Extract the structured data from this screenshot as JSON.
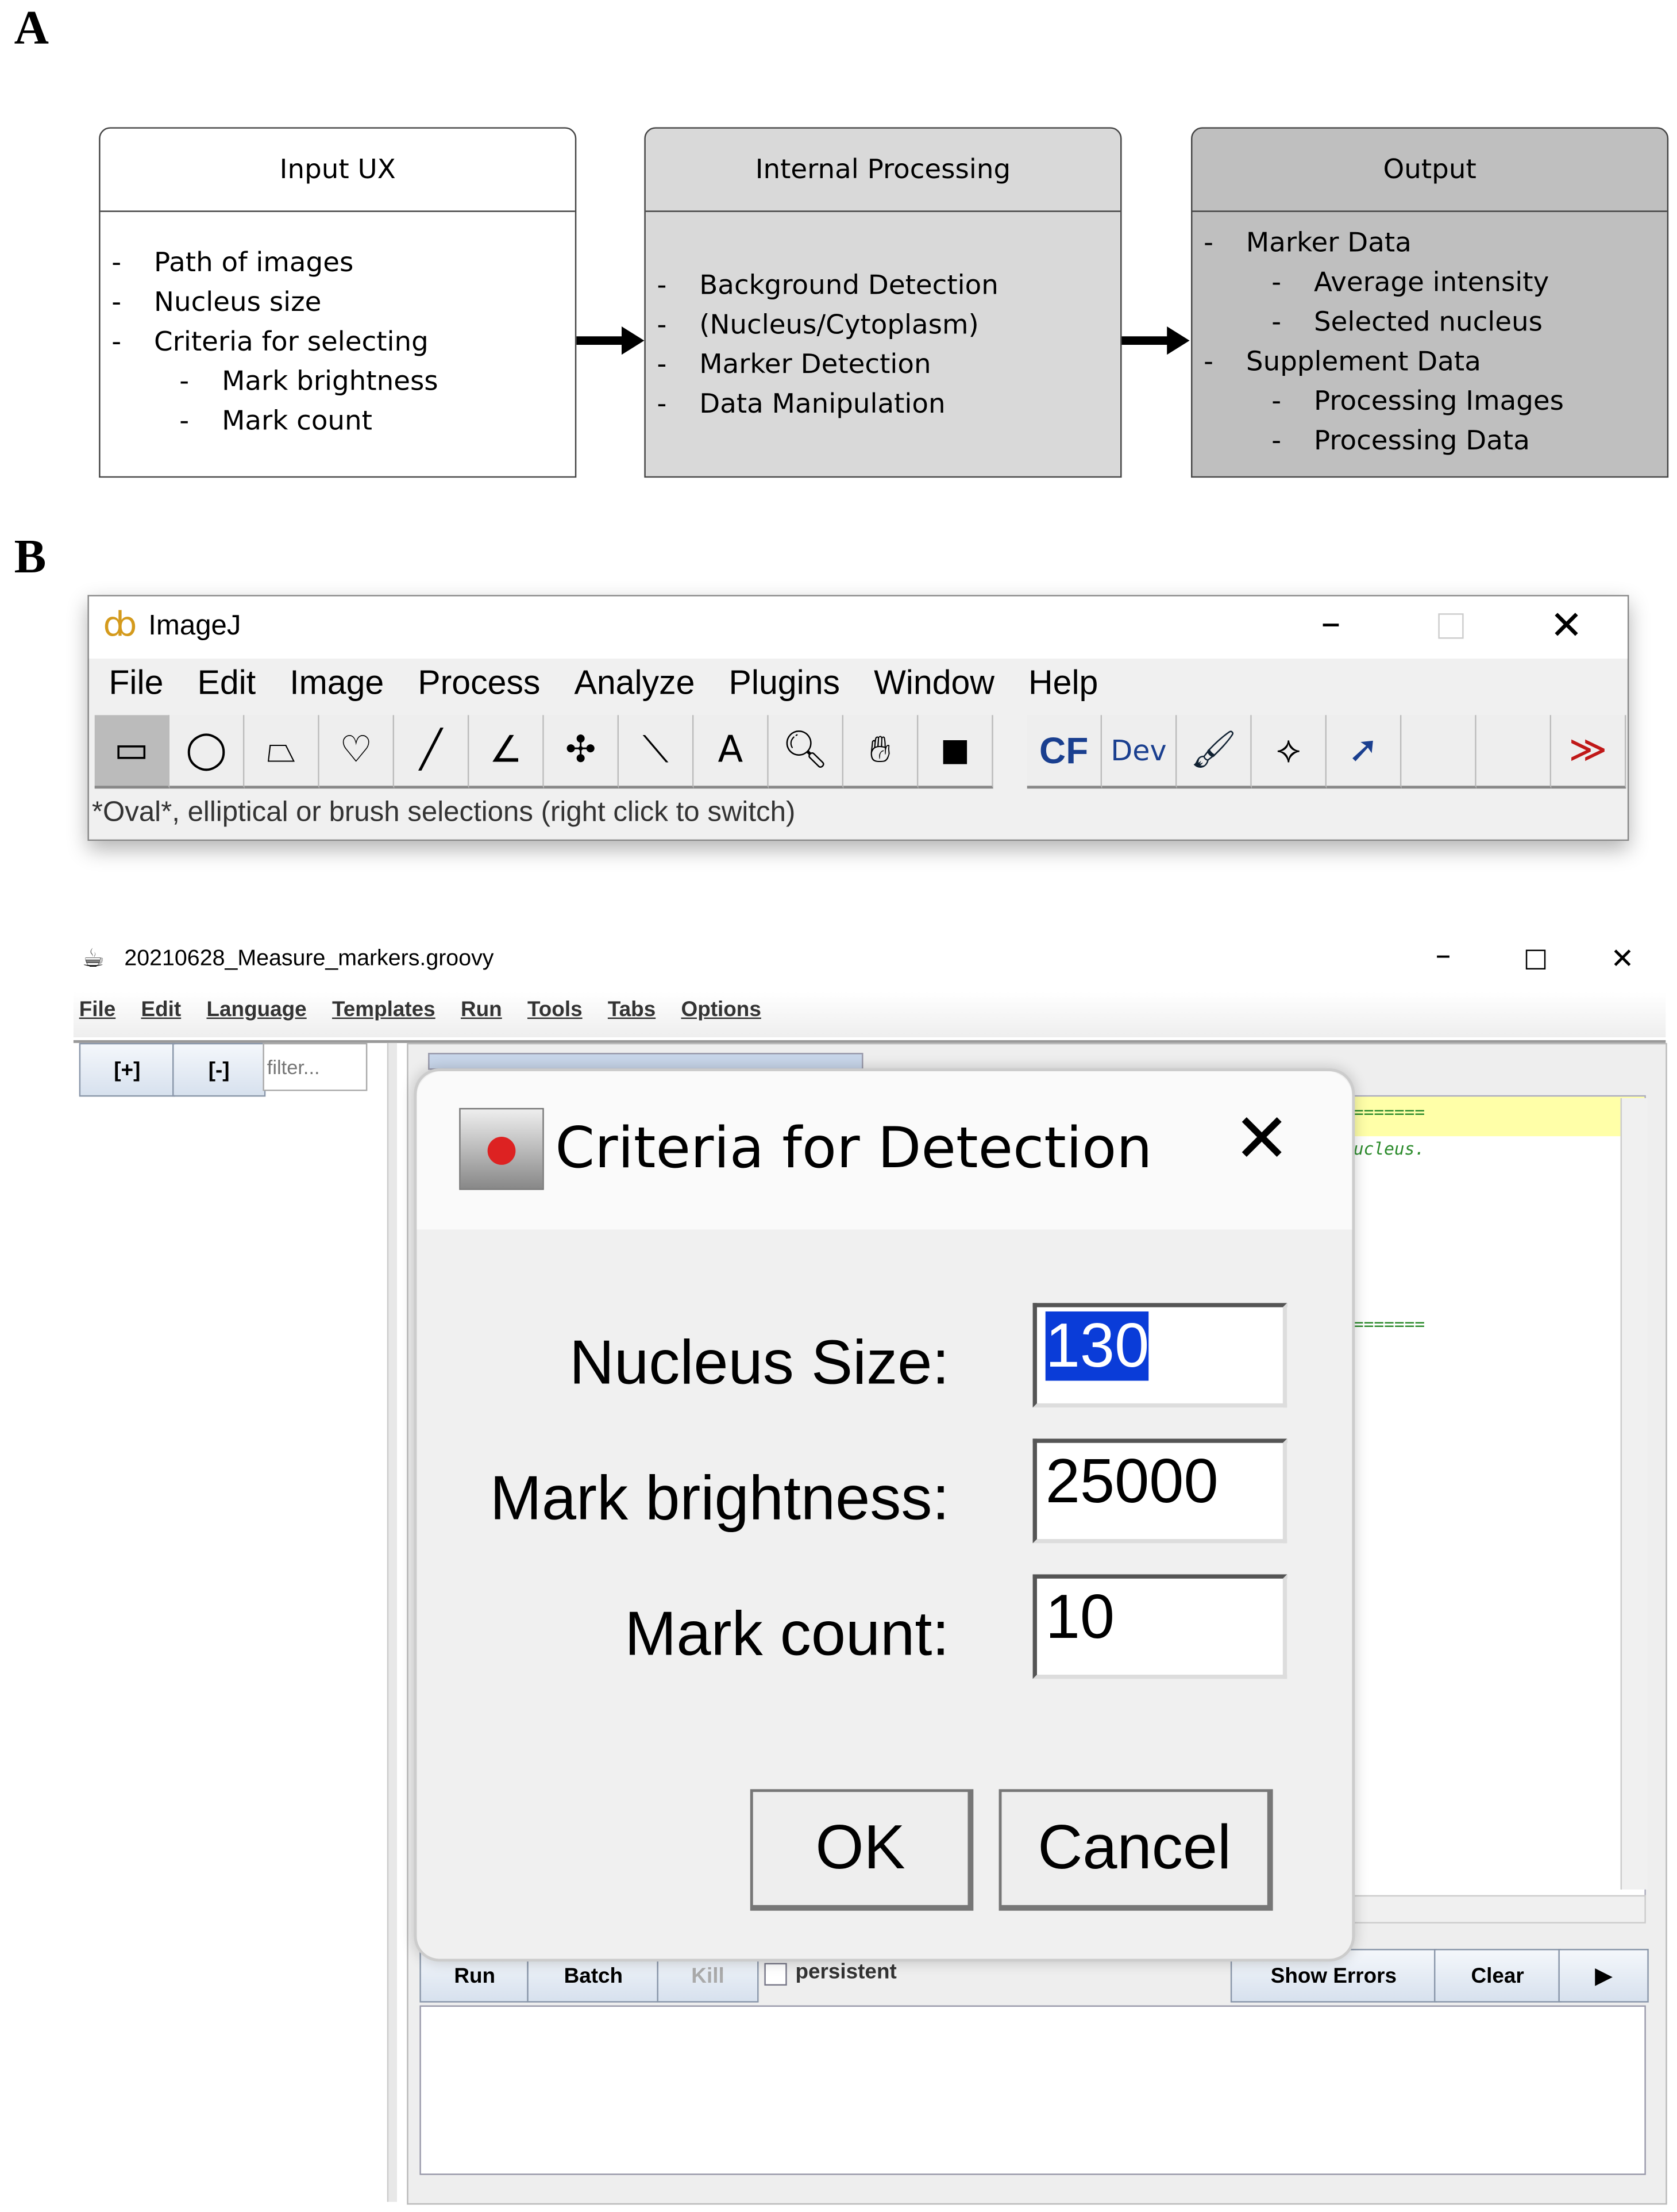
{
  "panel_a": {
    "label": "A",
    "input": {
      "title": "Input UX",
      "items": [
        "Path of images",
        "Nucleus size",
        "Criteria for selecting"
      ],
      "subitems": [
        "Mark brightness",
        "Mark count"
      ]
    },
    "internal": {
      "title": "Internal Processing",
      "items": [
        "Background  Detection",
        "(Nucleus/Cytoplasm)",
        "Marker Detection",
        "Data Manipulation"
      ]
    },
    "output": {
      "title": "Output",
      "marker": "Marker Data",
      "marker_sub": [
        "Average intensity",
        "Selected nucleus"
      ],
      "supplement": "Supplement Data",
      "supplement_sub": [
        "Processing Images",
        "Processing Data"
      ]
    }
  },
  "panel_b": {
    "label": "B"
  },
  "imagej": {
    "title": "ImageJ",
    "menu": [
      "File",
      "Edit",
      "Image",
      "Process",
      "Analyze",
      "Plugins",
      "Window",
      "Help"
    ],
    "tools": [
      "rectangle",
      "oval",
      "polygon",
      "freehand",
      "line",
      "angle",
      "multipoint",
      "wand",
      "text",
      "magnifier",
      "hand",
      "color-picker",
      "CF",
      "Dev",
      "brush",
      "flood-fill",
      "arrow",
      "empty",
      "empty",
      "more"
    ],
    "tool_cf": "CF",
    "tool_dev": "Dev",
    "more_glyph": "≫",
    "status": "*Oval*, elliptical or brush selections (right click to switch)"
  },
  "script_editor": {
    "title": "20210628_Measure_markers.groovy",
    "menu": [
      "File",
      "Edit",
      "Language",
      "Templates",
      "Run",
      "Tools",
      "Tabs",
      "Options"
    ],
    "expand": "[+]",
    "collapse": "[-]",
    "filter_placeholder": "filter...",
    "code_lines": [
      "=======",
      "ucleus.",
      "======="
    ],
    "run": "Run",
    "batch": "Batch",
    "kill": "Kill",
    "persistent": "persistent",
    "show_errors": "Show Errors",
    "clear": "Clear",
    "play": "▶"
  },
  "dialog": {
    "title": "Criteria for Detection",
    "fields": [
      {
        "label": "Nucleus Size:",
        "value": "130"
      },
      {
        "label": "Mark brightness:",
        "value": "25000"
      },
      {
        "label": "Mark count:",
        "value": "10"
      }
    ],
    "ok": "OK",
    "cancel": "Cancel"
  }
}
